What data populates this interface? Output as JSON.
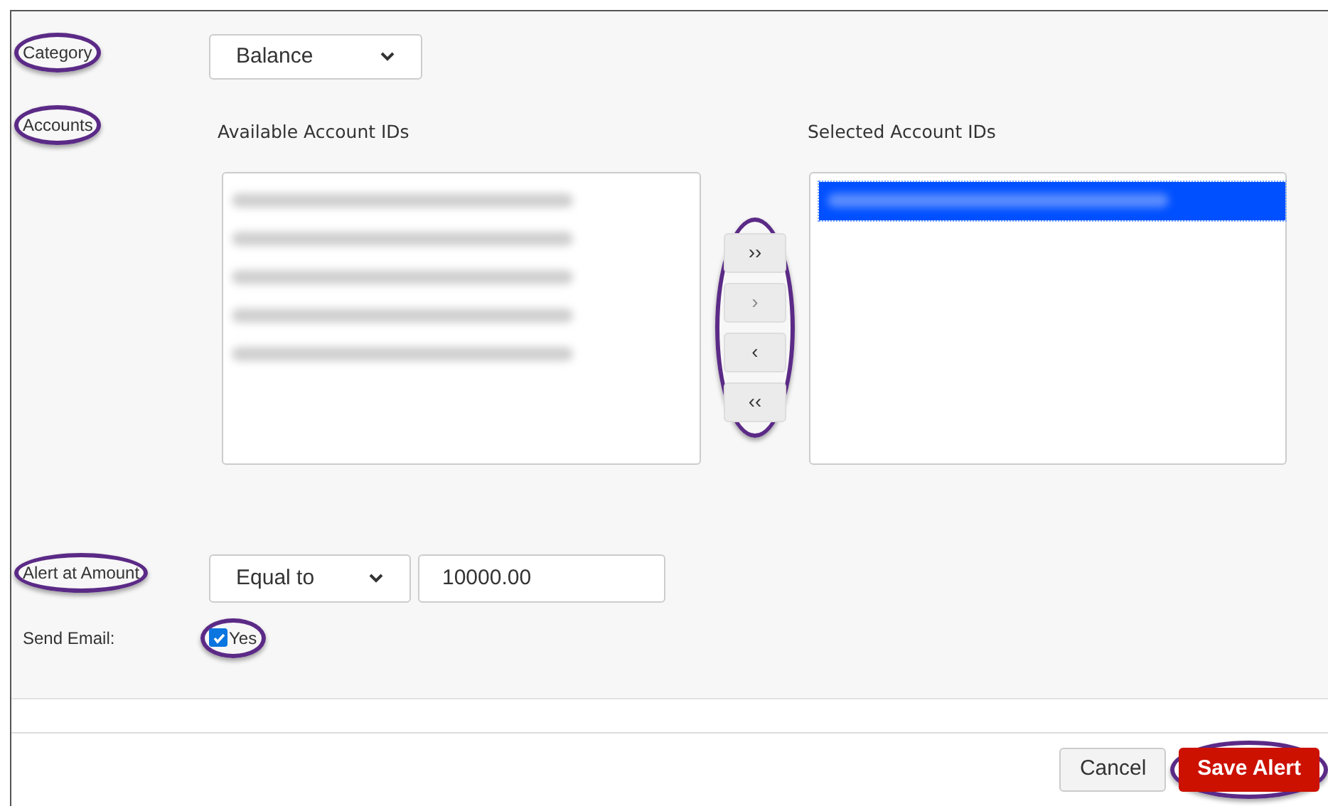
{
  "category": {
    "label": "Category",
    "highlighted": true,
    "value": "Balance"
  },
  "accounts": {
    "label": "Accounts",
    "highlighted": true,
    "available": {
      "heading": "Available Account IDs",
      "items": [
        {
          "kind": "blurred",
          "selected": false
        },
        {
          "kind": "blurred",
          "selected": false
        },
        {
          "kind": "blurred",
          "selected": false
        },
        {
          "kind": "blurred",
          "selected": false
        },
        {
          "kind": "blurred",
          "selected": false
        }
      ]
    },
    "transfer_buttons": {
      "highlighted": true,
      "buttons": [
        {
          "label": "››",
          "disabled": false
        },
        {
          "label": "›",
          "disabled": true
        },
        {
          "label": "‹",
          "disabled": false
        },
        {
          "label": "‹‹",
          "disabled": false
        }
      ]
    },
    "selected": {
      "heading": "Selected Account IDs",
      "items": [
        {
          "kind": "blurred",
          "selected": true
        }
      ]
    }
  },
  "alert_at_amount": {
    "label": "Alert at Amount",
    "highlighted": true,
    "operator": "Equal to",
    "amount": "10000.00"
  },
  "send_email": {
    "label": "Send Email:",
    "option": "Yes",
    "checked": true,
    "highlighted": true
  },
  "buttons": [
    {
      "label": "Cancel",
      "kind": "secondary",
      "highlighted": false
    },
    {
      "label": "Save Alert",
      "kind": "primary",
      "highlighted": true
    }
  ]
}
